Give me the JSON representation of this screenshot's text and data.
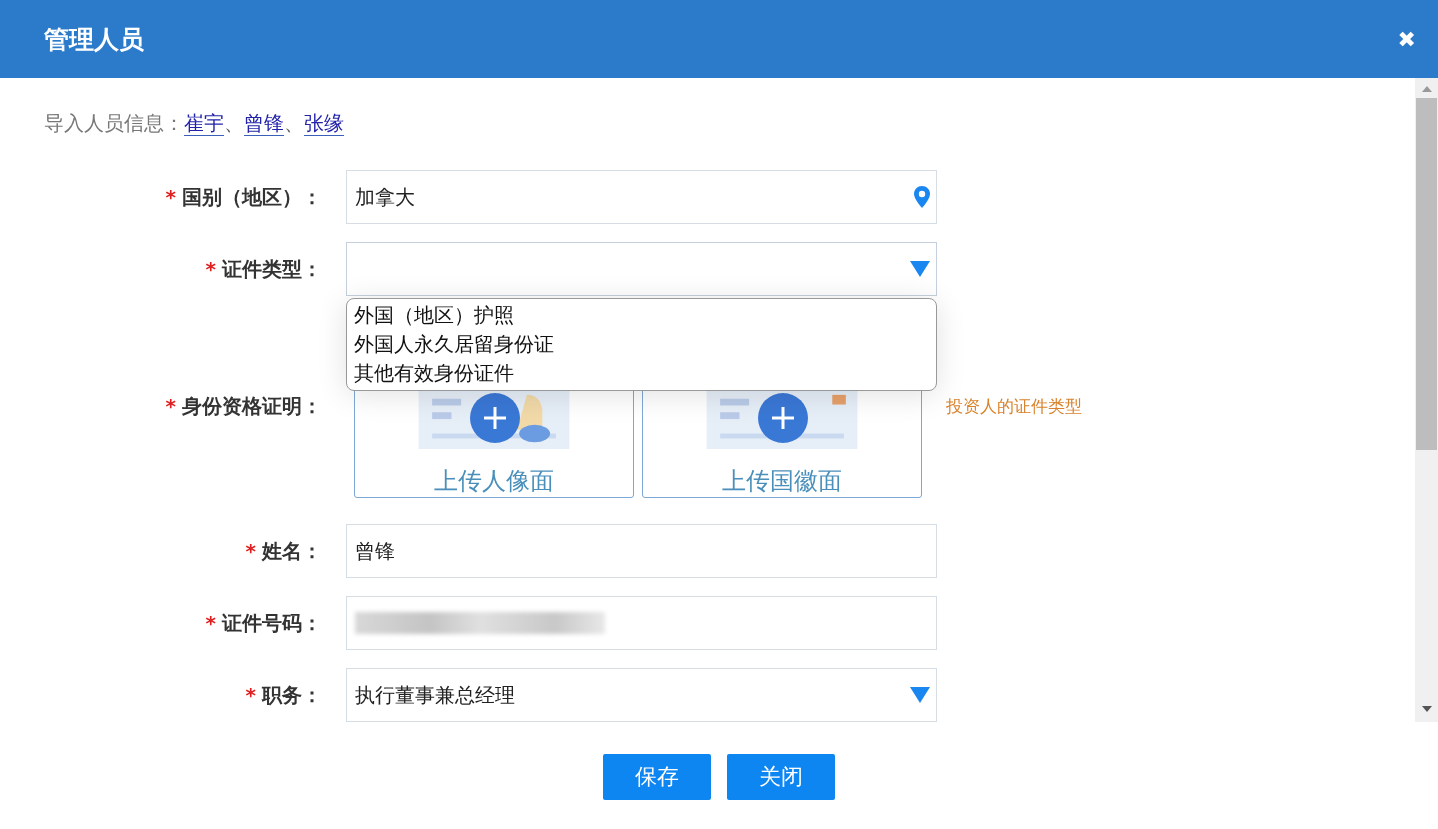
{
  "dialog": {
    "title": "管理人员",
    "close": "✖"
  },
  "import": {
    "label": "导入人员信息：",
    "people": [
      {
        "name": "崔宇",
        "separator": "、"
      },
      {
        "name": "曾锋",
        "separator": "、"
      },
      {
        "name": "张缘"
      }
    ]
  },
  "fields": [
    {
      "kind": "location",
      "required_mark": "*",
      "label": "国别（地区）：",
      "value": "加拿大"
    },
    {
      "kind": "select",
      "required_mark": "*",
      "label": "证件类型：",
      "expanded": true,
      "options": [
        "外国（地区）护照",
        "外国人永久居留身份证",
        "其他有效身份证件"
      ]
    },
    {
      "kind": "upload",
      "required_mark": "*",
      "label": "身份资格证明：",
      "cards": [
        "上传人像面",
        "上传国徽面"
      ],
      "hint": "投资人的证件类型"
    },
    {
      "kind": "text",
      "required_mark": "*",
      "label": "姓名：",
      "value": "曾锋"
    },
    {
      "kind": "redacted",
      "required_mark": "*",
      "label": "证件号码："
    },
    {
      "kind": "select",
      "required_mark": "*",
      "label": "职务：",
      "value": "执行董事兼总经理"
    }
  ],
  "buttons": [
    "保存",
    "关闭"
  ]
}
